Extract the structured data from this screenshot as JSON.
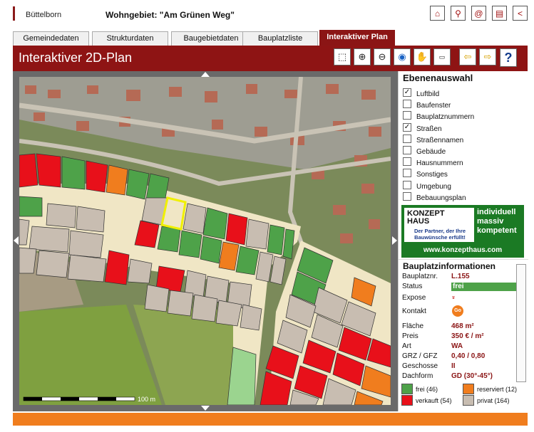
{
  "top": {
    "town": "Büttelborn",
    "area": "Wohngebiet: \"Am Grünen Weg\""
  },
  "top_icons": [
    "home-icon",
    "search-icon",
    "email-icon",
    "print-icon",
    "back-icon"
  ],
  "tabs": [
    {
      "label": "Gemeindedaten",
      "active": false
    },
    {
      "label": "Strukturdaten",
      "active": false
    },
    {
      "label": "Baugebietdaten",
      "active": false
    },
    {
      "label": "Bauplatzliste",
      "active": false
    },
    {
      "label": "Interaktiver Plan",
      "active": true
    }
  ],
  "header": {
    "title": "Interaktiver 2D-Plan"
  },
  "tools": [
    "zoom-box-icon",
    "zoom-in-icon",
    "zoom-out-icon",
    "globe-icon",
    "pan-hand-icon",
    "measure-icon",
    "previous-icon",
    "next-icon"
  ],
  "help_label": "?",
  "map": {
    "scale_label": "100 m"
  },
  "layers": {
    "title": "Ebenenauswahl",
    "items": [
      {
        "label": "Luftbild",
        "checked": true
      },
      {
        "label": "Baufenster",
        "checked": false
      },
      {
        "label": "Bauplatznummern",
        "checked": false
      },
      {
        "label": "Straßen",
        "checked": true
      },
      {
        "label": "Straßennamen",
        "checked": false
      },
      {
        "label": "Gebäude",
        "checked": false
      },
      {
        "label": "Hausnummern",
        "checked": false
      },
      {
        "label": "Sonstiges",
        "checked": false
      },
      {
        "label": "Umgebung",
        "checked": false
      },
      {
        "label": "Bebauungsplan",
        "checked": false
      }
    ]
  },
  "ad": {
    "name_line1": "KONZEPT",
    "name_line2": "HAUS",
    "slogan": "Der Partner, der Ihre Bauwünsche erfüllt!",
    "claim": [
      "individuell",
      "massiv",
      "kompetent"
    ],
    "url": "www.konzepthaus.com"
  },
  "info": {
    "title": "Bauplatzinformationen",
    "rows": [
      {
        "key": "Bauplatznr.",
        "value": "L.155"
      },
      {
        "key": "Status",
        "value": "frei"
      },
      {
        "key": "Expose",
        "value": ""
      },
      {
        "key": "Kontakt",
        "value": ""
      },
      {
        "key": "Fläche",
        "value": "468 m²"
      },
      {
        "key": "Preis",
        "value": "350 € / m²"
      },
      {
        "key": "Art",
        "value": "WA"
      },
      {
        "key": "GRZ / GFZ",
        "value": "0,40 / 0,80"
      },
      {
        "key": "Geschosse",
        "value": "II"
      },
      {
        "key": "Dachform",
        "value": "GD (30°-45°)"
      }
    ]
  },
  "legend": [
    {
      "label": "frei (46)",
      "color": "#4ea249"
    },
    {
      "label": "reserviert (12)",
      "color": "#f07d1e"
    },
    {
      "label": "verkauft (54)",
      "color": "#e8101a"
    },
    {
      "label": "privat (164)",
      "color": "#c8bdb1"
    }
  ],
  "colors": {
    "brand": "#8e1414",
    "accent": "#f07d1e",
    "free": "#4ea249",
    "reserved": "#f07d1e",
    "sold": "#e8101a",
    "private": "#c8bdb1"
  }
}
